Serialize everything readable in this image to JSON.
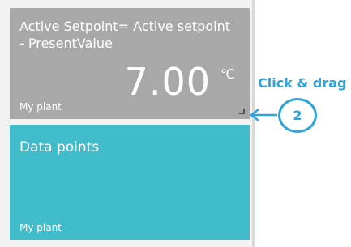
{
  "setpoint_tile": {
    "title": "Active Setpoint= Active setpoint - PresentValue",
    "value": "7.00",
    "unit": "℃",
    "footer": "My plant"
  },
  "datapoints_tile": {
    "title": "Data points",
    "footer": "My plant"
  },
  "callout": {
    "label": "Click & drag",
    "step_number": "2"
  },
  "colors": {
    "setpoint_tile_bg": "#a8a8a8",
    "datapoints_tile_bg": "#41bccb",
    "callout_accent": "#2ea4dc"
  },
  "icons": {
    "resize_handle": "resize-handle-icon",
    "callout_arrow": "arrow-left-icon"
  }
}
